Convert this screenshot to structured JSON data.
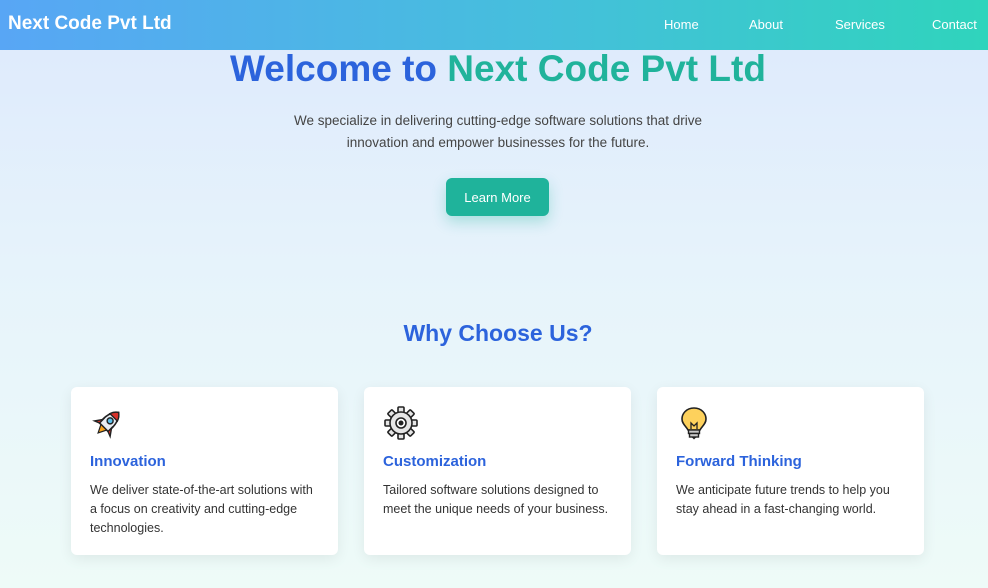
{
  "nav": {
    "brand": "Next Code Pvt Ltd",
    "links": [
      "Home",
      "About",
      "Services",
      "Contact"
    ]
  },
  "hero": {
    "title_part1": "Welcome to",
    "title_part2": "Next Code Pvt Ltd",
    "text": "We specialize in delivering cutting-edge software solutions that drive innovation and empower businesses for the future.",
    "button": "Learn More"
  },
  "features": {
    "title": "Why Choose Us?",
    "cards": [
      {
        "icon": "rocket-icon",
        "title": "Innovation",
        "text": "We deliver state-of-the-art solutions with a focus on creativity and cutting-edge technologies."
      },
      {
        "icon": "gear-icon",
        "title": "Customization",
        "text": "Tailored software solutions designed to meet the unique needs of your business."
      },
      {
        "icon": "lightbulb-icon",
        "title": "Forward Thinking",
        "text": "We anticipate future trends to help you stay ahead in a fast-changing world."
      }
    ]
  },
  "colors": {
    "primary_blue": "#2c63dc",
    "teal": "#20b39b",
    "nav_gradient_start": "#58a6f5",
    "nav_gradient_end": "#2fd4bc"
  }
}
